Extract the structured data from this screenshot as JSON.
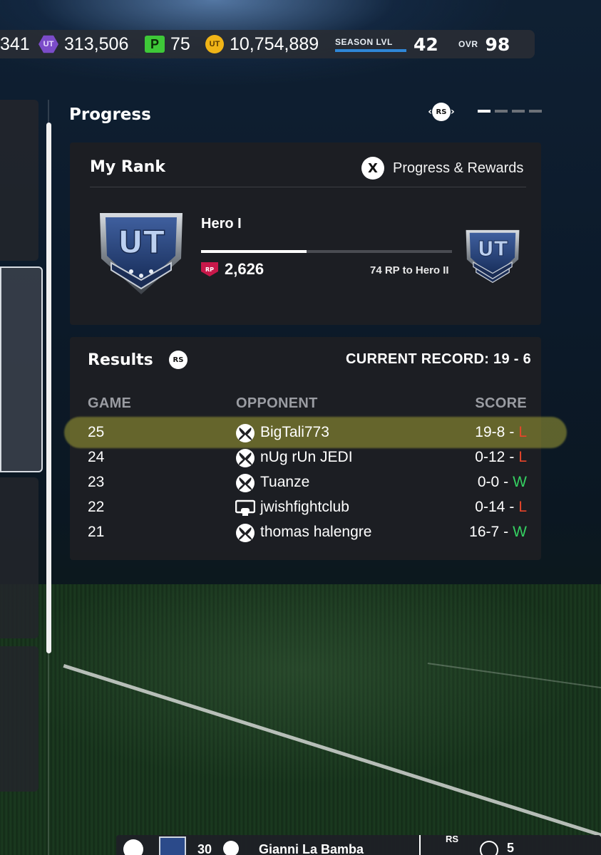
{
  "currency": {
    "partial_value": "341",
    "ut_purple": "313,506",
    "points": "75",
    "ut_coins": "10,754,889",
    "season_label": "SEASON LVL",
    "season_level": "42",
    "ovr_label": "OVR",
    "ovr_value": "98",
    "icons": {
      "ut_purple": "UT",
      "points": "P",
      "ut_coins": "UT"
    }
  },
  "progress": {
    "title": "Progress",
    "rs_label": "RS",
    "pages": 4,
    "active_page": 1
  },
  "rank": {
    "title": "My Rank",
    "x_button": "X",
    "rewards_label": "Progress & Rewards",
    "rank_name": "Hero I",
    "rp_icon": "RP",
    "rp_value": "2,626",
    "progress_fraction": 0.42,
    "to_next": "74 RP to Hero II"
  },
  "results": {
    "title": "Results",
    "rs_label": "RS",
    "record": "CURRENT RECORD: 19 - 6",
    "columns": {
      "game": "GAME",
      "opponent": "OPPONENT",
      "score": "SCORE"
    },
    "rows": [
      {
        "game": "25",
        "platform": "xbox",
        "opponent": "BigTali773",
        "score": "19-8",
        "sep": "-",
        "result": "L"
      },
      {
        "game": "24",
        "platform": "xbox",
        "opponent": "nUg rUn JEDI",
        "score": "0-12",
        "sep": "-",
        "result": "L"
      },
      {
        "game": "23",
        "platform": "xbox",
        "opponent": "Tuanze",
        "score": "0-0",
        "sep": "-",
        "result": "W"
      },
      {
        "game": "22",
        "platform": "pc",
        "opponent": "jwishfightclub",
        "score": "0-14",
        "sep": "-",
        "result": "L"
      },
      {
        "game": "21",
        "platform": "xbox",
        "opponent": "thomas halengre",
        "score": "16-7",
        "sep": "-",
        "result": "W"
      }
    ],
    "colors": {
      "L": "#e7452a",
      "W": "#35d061",
      "highlight": "#a3a034"
    }
  },
  "bottom": {
    "number": "30",
    "name": "Gianni La Bamba",
    "rs_label": "RS",
    "trailing": "5"
  }
}
